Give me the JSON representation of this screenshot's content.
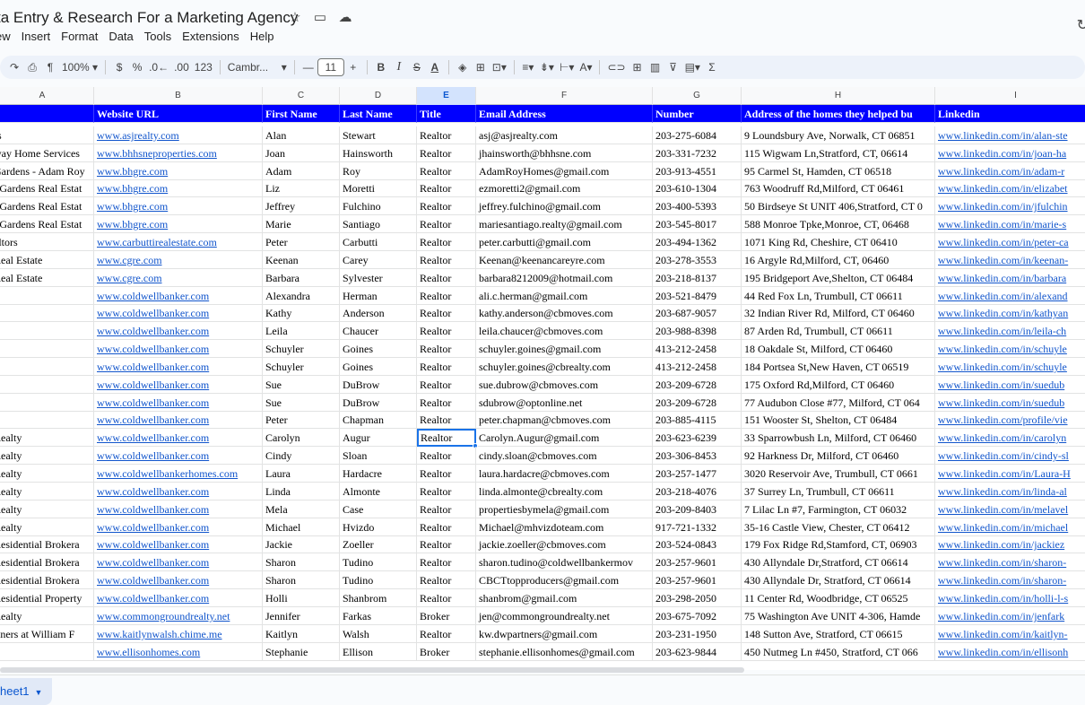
{
  "document": {
    "title": "ta Entry & Research For a Marketing Agency",
    "title_icons": [
      "star-icon",
      "folder-move-icon",
      "cloud-saved-icon"
    ]
  },
  "menu": [
    "ew",
    "Insert",
    "Format",
    "Data",
    "Tools",
    "Extensions",
    "Help"
  ],
  "toolbar": {
    "zoom": "100%",
    "currency": "$",
    "percent": "%",
    "decrease_decimal": ".0←",
    "increase_decimal": ".00",
    "number_format": "123",
    "font": "Cambr...",
    "font_size": "11",
    "minus": "—",
    "plus": "+",
    "bold": "B",
    "italic": "I",
    "strike": "S",
    "underline_a": "A",
    "sigma": "Σ"
  },
  "columns": [
    "A",
    "B",
    "C",
    "D",
    "E",
    "F",
    "G",
    "H",
    "I"
  ],
  "active_column": "E",
  "header_row": [
    "",
    "Website URL",
    "First Name",
    "Last Name",
    "Title",
    "Email Address",
    "Number",
    "Address of the homes they helped bu",
    "Linkedin"
  ],
  "rows": [
    [
      "rs",
      "www.asjrealty.com",
      "Alan",
      "Stewart",
      "Realtor",
      "asj@asjrealty.com",
      "203-275-6084",
      "9 Loundsbury Ave, Norwalk, CT 06851",
      "www.linkedin.com/in/alan-ste"
    ],
    [
      "way Home Services",
      "www.bhhsneproperties.com",
      "Joan",
      "Hainsworth",
      "Realtor",
      "jhainsworth@bhhsne.com",
      "203-331-7232",
      "115 Wigwam Ln,Stratford, CT, 06614",
      "www.linkedin.com/in/joan-ha"
    ],
    [
      "Gardens - Adam Roy",
      "www.bhgre.com",
      "Adam",
      "Roy",
      "Realtor",
      "AdamRoyHomes@gmail.com",
      "203-913-4551",
      "95 Carmel St, Hamden, CT 06518",
      "www.linkedin.com/in/adam-r"
    ],
    [
      "l Gardens Real Estat",
      "www.bhgre.com",
      "Liz",
      "Moretti",
      "Realtor",
      "ezmoretti2@gmail.com",
      "203-610-1304",
      "763 Woodruff Rd,Milford, CT 06461",
      "www.linkedin.com/in/elizabet"
    ],
    [
      "l Gardens Real Estat",
      "www.bhgre.com",
      "Jeffrey",
      "Fulchino",
      "Realtor",
      "jeffrey.fulchino@gmail.com",
      "203-400-5393",
      "50 Birdseye St UNIT 406,Stratford, CT 0",
      "www.linkedin.com/in/jfulchin"
    ],
    [
      "l Gardens Real Estat",
      "www.bhgre.com",
      "Marie",
      "Santiago",
      "Realtor",
      "mariesantiago.realty@gmail.com",
      "203-545-8017",
      "588 Monroe Tpke,Monroe, CT, 06468",
      "www.linkedin.com/in/marie-s"
    ],
    [
      "altors",
      "www.carbuttirealestate.com",
      "Peter",
      "Carbutti",
      "Realtor",
      "peter.carbutti@gmail.com",
      "203-494-1362",
      "1071 King Rd, Cheshire, CT 06410",
      "www.linkedin.com/in/peter-ca"
    ],
    [
      " Real Estate",
      "www.cgre.com",
      "Keenan",
      "Carey",
      "Realtor",
      "Keenan@keenancareyre.com",
      "203-278-3553",
      "16 Argyle Rd,Milford, CT, 06460",
      "www.linkedin.com/in/keenan-"
    ],
    [
      "Real Estate",
      "www.cgre.com",
      "Barbara",
      "Sylvester",
      "Realtor",
      "barbara8212009@hotmail.com",
      "203-218-8137",
      "195 Bridgeport Ave,Shelton, CT 06484",
      "www.linkedin.com/in/barbara"
    ],
    [
      "",
      "www.coldwellbanker.com",
      "Alexandra",
      "Herman",
      "Realtor",
      "ali.c.herman@gmail.com",
      "203-521-8479",
      "44 Red Fox Ln, Trumbull, CT 06611",
      "www.linkedin.com/in/alexand"
    ],
    [
      "",
      "www.coldwellbanker.com",
      "Kathy",
      "Anderson",
      "Realtor",
      "kathy.anderson@cbmoves.com",
      "203-687-9057",
      "32 Indian River Rd, Milford, CT 06460",
      "www.linkedin.com/in/kathyan"
    ],
    [
      "",
      "www.coldwellbanker.com",
      "Leila",
      "Chaucer",
      "Realtor",
      "leila.chaucer@cbmoves.com",
      "203-988-8398",
      "87 Arden Rd, Trumbull, CT 06611",
      "www.linkedin.com/in/leila-ch"
    ],
    [
      "",
      "www.coldwellbanker.com",
      "Schuyler",
      "Goines",
      "Realtor",
      "schuyler.goines@gmail.com",
      "413-212-2458",
      "18 Oakdale St, Milford, CT 06460",
      "www.linkedin.com/in/schuyle"
    ],
    [
      "",
      "www.coldwellbanker.com",
      "Schuyler",
      "Goines",
      "Realtor",
      "schuyler.goines@cbrealty.com",
      "413-212-2458",
      "184 Portsea St,New Haven, CT 06519",
      "www.linkedin.com/in/schuyle"
    ],
    [
      "",
      "www.coldwellbanker.com",
      "Sue",
      "DuBrow",
      "Realtor",
      "sue.dubrow@cbmoves.com",
      "203-209-6728",
      "175 Oxford Rd,Milford, CT 06460",
      "www.linkedin.com/in/suedub"
    ],
    [
      "",
      "www.coldwellbanker.com",
      "Sue",
      "DuBrow",
      "Realtor",
      "sdubrow@optonline.net",
      "203-209-6728",
      "77 Audubon Close #77, Milford, CT 064",
      "www.linkedin.com/in/suedub"
    ],
    [
      "",
      "www.coldwellbanker.com",
      "Peter",
      "Chapman",
      "Realtor",
      "peter.chapman@cbmoves.com",
      "203-885-4115",
      "151 Wooster St, Shelton, CT 06484",
      "www.linkedin.com/profile/vie"
    ],
    [
      "Realty",
      "www.coldwellbanker.com",
      "Carolyn",
      "Augur",
      "Realtor",
      "Carolyn.Augur@gmail.com",
      "203-623-6239",
      "33 Sparrowbush Ln, Milford, CT 06460",
      "www.linkedin.com/in/carolyn"
    ],
    [
      "Realty",
      "www.coldwellbanker.com",
      "Cindy",
      "Sloan",
      "Realtor",
      "cindy.sloan@cbmoves.com",
      "203-306-8453",
      "92 Harkness Dr, Milford, CT 06460",
      "www.linkedin.com/in/cindy-sl"
    ],
    [
      "Realty",
      "www.coldwellbankerhomes.com",
      "Laura",
      "Hardacre",
      "Realtor",
      "laura.hardacre@cbmoves.com",
      "203-257-1477",
      "3020 Reservoir Ave, Trumbull, CT 0661",
      "www.linkedin.com/in/Laura-H"
    ],
    [
      "Realty",
      "www.coldwellbanker.com",
      "Linda",
      "Almonte",
      "Realtor",
      "linda.almonte@cbrealty.com",
      "203-218-4076",
      "37 Surrey Ln, Trumbull, CT 06611",
      "www.linkedin.com/in/linda-al"
    ],
    [
      "Realty",
      "www.coldwellbanker.com",
      "Mela",
      "Case",
      "Realtor",
      "propertiesbymela@gmail.com",
      "203-209-8403",
      "7 Lilac Ln #7, Farmington, CT 06032",
      "www.linkedin.com/in/melavel"
    ],
    [
      "Realty",
      "www.coldwellbanker.com",
      "Michael",
      "Hvizdo",
      "Realtor",
      "Michael@mhvizdoteam.com",
      "917-721-1332",
      "35-16 Castle View, Chester, CT 06412",
      "www.linkedin.com/in/michael"
    ],
    [
      "Residential Brokera",
      "www.coldwellbanker.com",
      "Jackie",
      "Zoeller",
      "Realtor",
      "jackie.zoeller@cbmoves.com",
      "203-524-0843",
      "179 Fox Ridge Rd,Stamford, CT, 06903",
      "www.linkedin.com/in/jackiez"
    ],
    [
      "Residential Brokera",
      "www.coldwellbanker.com",
      "Sharon",
      "Tudino",
      "Realtor",
      "sharon.tudino@coldwellbankermov",
      "203-257-9601",
      "430 Allyndale Dr,Stratford, CT 06614",
      "www.linkedin.com/in/sharon-"
    ],
    [
      "Residential Brokera",
      "www.coldwellbanker.com",
      "Sharon",
      "Tudino",
      "Realtor",
      "CBCTtopproducers@gmail.com",
      "203-257-9601",
      "430 Allyndale Dr, Stratford, CT 06614",
      "www.linkedin.com/in/sharon-"
    ],
    [
      "Residential Property",
      "www.coldwellbanker.com",
      "Holli",
      "Shanbrom",
      "Realtor",
      "shanbrom@gmail.com",
      "203-298-2050",
      "11 Center Rd, Woodbridge, CT 06525",
      "www.linkedin.com/in/holli-l-s"
    ],
    [
      " Realty",
      "www.commongroundrealty.net",
      "Jennifer",
      "Farkas",
      "Broker",
      "jen@commongroundrealty.net",
      "203-675-7092",
      "75 Washington Ave UNIT 4-306, Hamde",
      "www.linkedin.com/in/jenfark"
    ],
    [
      "rtners at William F",
      "www.kaitlynwalsh.chime.me",
      "Kaitlyn",
      "Walsh",
      "Realtor",
      "kw.dwpartners@gmail.com",
      "203-231-1950",
      "148 Sutton Ave, Stratford, CT 06615",
      "www.linkedin.com/in/kaitlyn-"
    ],
    [
      "",
      "www.ellisonhomes.com",
      "Stephanie",
      "Ellison",
      "Broker",
      "stephanie.ellisonhomes@gmail.com",
      "203-623-9844",
      "450 Nutmeg Ln #450, Stratford, CT 066",
      "www.linkedin.com/in/ellisonh"
    ]
  ],
  "sheet": {
    "name": "heet1"
  },
  "colors": {
    "header_fill": "#0000ff",
    "link": "#1155cc",
    "selection": "#1a73e8"
  }
}
